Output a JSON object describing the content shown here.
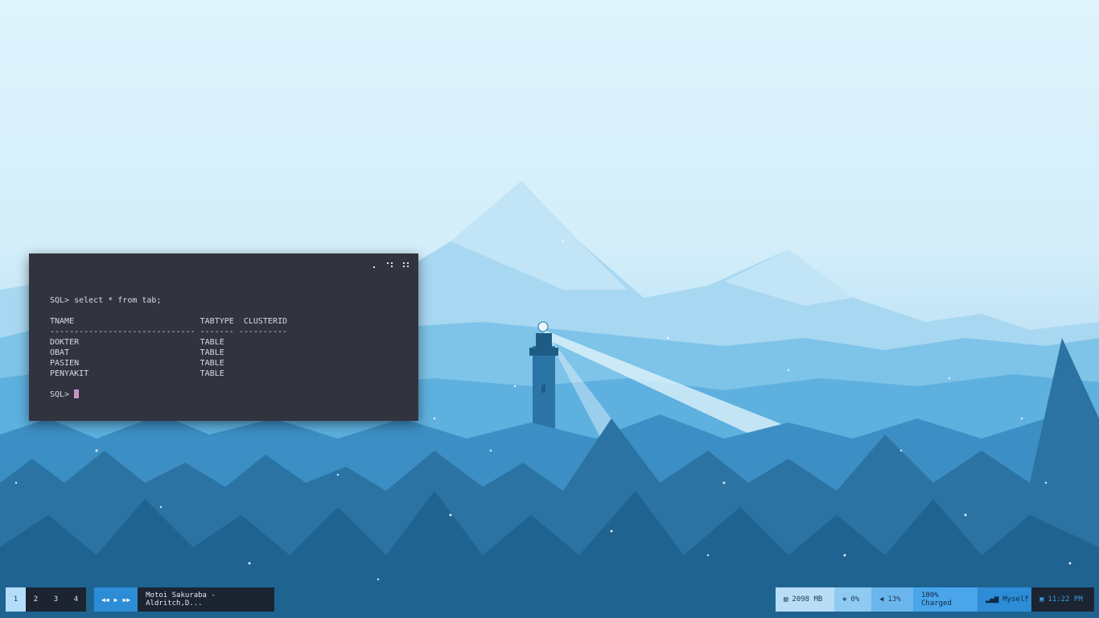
{
  "terminal": {
    "lines": [
      "SQL> select * from tab;",
      "",
      "TNAME                          TABTYPE  CLUSTERID",
      "------------------------------ ------- ----------",
      "DOKTER                         TABLE",
      "OBAT                           TABLE",
      "PASIEN                         TABLE",
      "PENYAKIT                       TABLE",
      ""
    ],
    "prompt": "SQL> "
  },
  "taskbar": {
    "workspaces": [
      "1",
      "2",
      "3",
      "4"
    ],
    "active_workspace": "1",
    "media": {
      "prev_icon": "rewind-icon",
      "play_icon": "play-icon",
      "next_icon": "fast-forward-icon",
      "now_playing": "Motoi Sakuraba - Aldritch,D..."
    },
    "memory": "2098 MB",
    "cpu": "0%",
    "volume": "13%",
    "battery": "100% Charged",
    "network": "Myself",
    "clock": "11:22 PM"
  },
  "colors": {
    "terminal_bg": "#31333e",
    "cursor": "#c596c7",
    "bar_dark": "#1b2430",
    "bar_accent": "#2d8cd6",
    "active_workspace": "#b3defa"
  }
}
